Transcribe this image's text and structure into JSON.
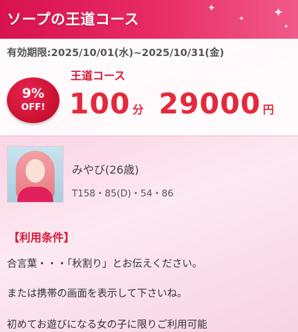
{
  "header": {
    "title": "ソープの王道コース"
  },
  "coupon": {
    "period": "有効期限:2025/10/01(水)~2025/10/31(金)",
    "badge_percent": "9%",
    "badge_off": "OFF!",
    "course_name": "王道コース",
    "duration": "100",
    "duration_unit": "分",
    "price": "29000",
    "price_unit": "円"
  },
  "profile": {
    "name": "みやび(26歳)",
    "stats": "T158・85(D)・54・86"
  },
  "conditions": {
    "heading": "【利用条件】",
    "lines": [
      "合言葉・・・「秋割り」とお伝えください。",
      "または携帯の画面を表示して下さいね。",
      "初めてお遊びになる女の子に限りご利用可能"
    ]
  },
  "colors": {
    "header": "#e01e5a",
    "accent_red": "#e22a3c",
    "badge": "#c8102e"
  }
}
